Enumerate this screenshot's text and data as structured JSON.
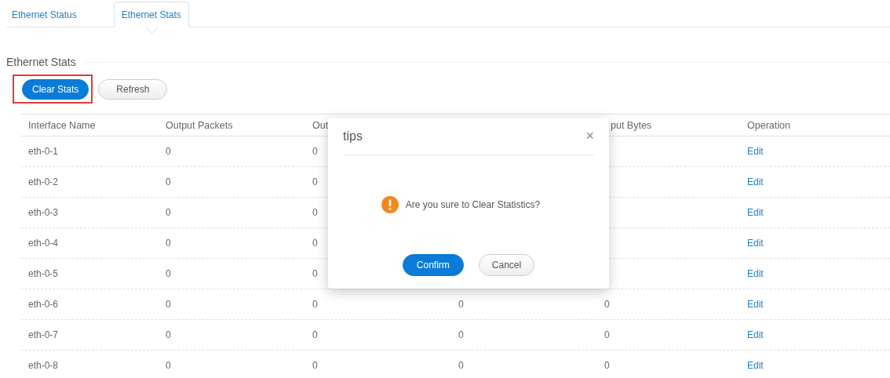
{
  "tabs": [
    {
      "label": "Ethernet Status",
      "selected": false
    },
    {
      "label": "Ethernet Stats",
      "selected": true
    }
  ],
  "section": {
    "title": "Ethernet Stats"
  },
  "buttons": [
    {
      "label": "Clear Stats",
      "kind": "primary",
      "highlighted": true
    },
    {
      "label": "Refresh",
      "kind": "default",
      "highlighted": false
    }
  ],
  "table": {
    "header": {
      "interface": "Interface Name",
      "output_packets": "Output Packets",
      "column_3": "Out",
      "column_5": "put Bytes",
      "operation": "Operation"
    },
    "rows": [
      {
        "interface": "eth-0-1",
        "output_packets": "0",
        "column_3": "0",
        "operation": "Edit"
      },
      {
        "interface": "eth-0-2",
        "output_packets": "0",
        "column_3": "0",
        "operation": "Edit"
      },
      {
        "interface": "eth-0-3",
        "output_packets": "0",
        "column_3": "0",
        "operation": "Edit"
      },
      {
        "interface": "eth-0-4",
        "output_packets": "0",
        "column_3": "0",
        "operation": "Edit"
      },
      {
        "interface": "eth-0-5",
        "output_packets": "0",
        "column_3": "0",
        "operation": "Edit"
      },
      {
        "interface": "eth-0-6",
        "output_packets": "0",
        "column_3": "0",
        "column_4": "0",
        "column_5": "0",
        "operation": "Edit"
      },
      {
        "interface": "eth-0-7",
        "output_packets": "0",
        "column_3": "0",
        "column_4": "0",
        "column_5": "0",
        "operation": "Edit"
      },
      {
        "interface": "eth-0-8",
        "output_packets": "0",
        "column_3": "0",
        "column_4": "0",
        "column_5": "0",
        "operation": "Edit"
      }
    ]
  },
  "dialog": {
    "title": "tips",
    "close": "×",
    "message": "Are you sure to Clear Statistics?",
    "buttons": [
      {
        "label": "Confirm",
        "kind": "primary"
      },
      {
        "label": "Cancel",
        "kind": "default"
      }
    ]
  }
}
